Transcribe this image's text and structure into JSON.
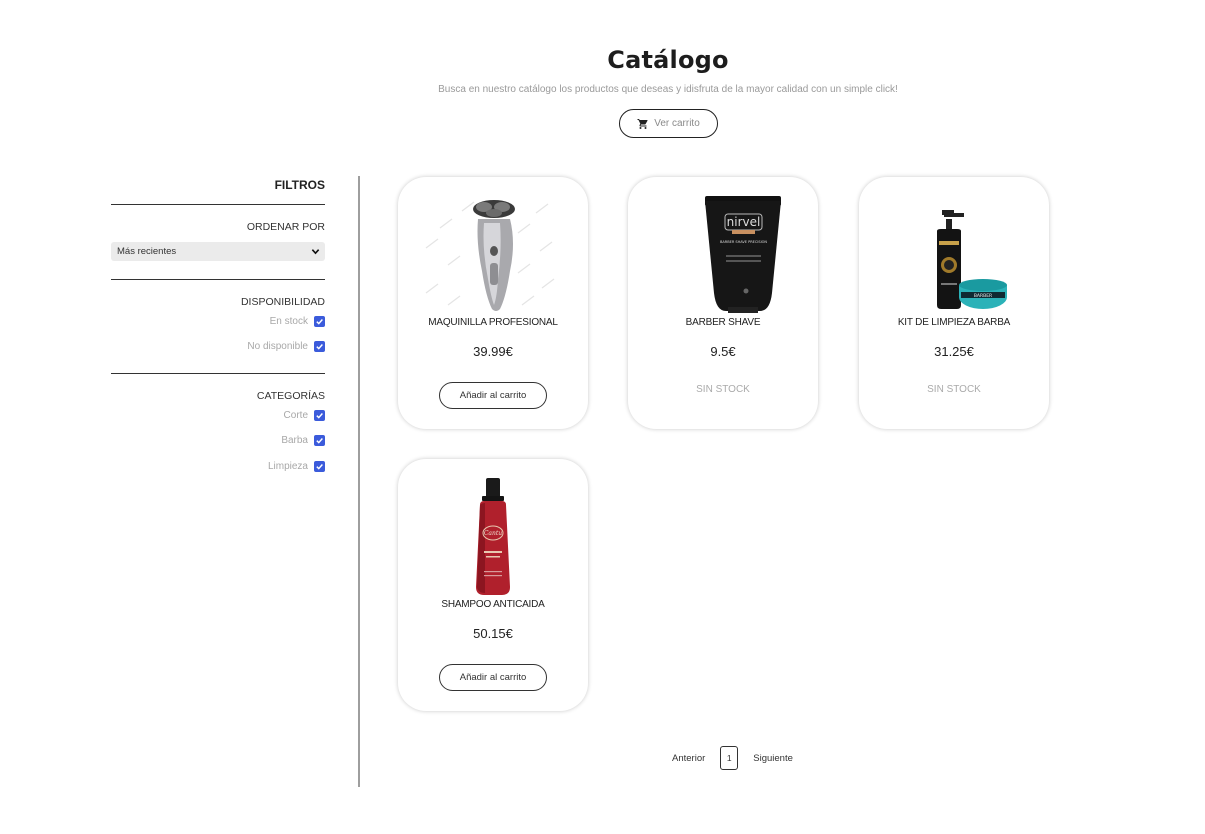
{
  "header": {
    "title": "Catálogo",
    "subtitle": "Busca en nuestro catálogo los productos que deseas y idisfruta de la mayor calidad con un simple click!",
    "cart_button": "Ver carrito",
    "cart_icon": "cart-icon"
  },
  "filters": {
    "heading": "FILTROS",
    "sort": {
      "label": "ORDENAR POR",
      "selected": "Más recientes"
    },
    "availability": {
      "label": "DISPONIBILIDAD",
      "options": [
        {
          "label": "En stock",
          "checked": true
        },
        {
          "label": "No disponible",
          "checked": true
        }
      ]
    },
    "categories": {
      "label": "CATEGORÍAS",
      "options": [
        {
          "label": "Corte",
          "checked": true
        },
        {
          "label": "Barba",
          "checked": true
        },
        {
          "label": "Limpieza",
          "checked": true
        }
      ]
    },
    "checkbox_color": "#3b5bdb"
  },
  "products": [
    {
      "name": "MAQUINILLA PROFESIONAL",
      "price": "39.99€",
      "action": "Añadir al carrito",
      "in_stock": true
    },
    {
      "name": "BARBER SHAVE",
      "price": "9.5€",
      "action": "SIN STOCK",
      "in_stock": false,
      "image_text": "nirvel",
      "image_subtext": "BARBER SHAVE PRECISION"
    },
    {
      "name": "KIT DE LIMPIEZA BARBA",
      "price": "31.25€",
      "action": "SIN STOCK",
      "in_stock": false
    },
    {
      "name": "SHAMPOO ANTICAIDA",
      "price": "50.15€",
      "action": "Añadir al carrito",
      "in_stock": true
    }
  ],
  "pagination": {
    "prev": "Anterior",
    "page": "1",
    "next": "Siguiente"
  }
}
